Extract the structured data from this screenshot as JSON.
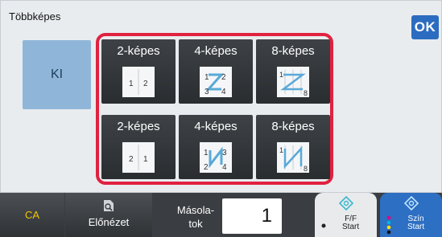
{
  "panel": {
    "title": "Többképes",
    "ok_label": "OK",
    "off_label": "KI"
  },
  "options": [
    {
      "label": "2-képes",
      "icon": "2up-left-right-icon"
    },
    {
      "label": "4-képes",
      "icon": "4up-z-order-icon"
    },
    {
      "label": "8-képes",
      "icon": "8up-z-order-icon"
    },
    {
      "label": "2-képes",
      "icon": "2up-right-left-icon"
    },
    {
      "label": "4-képes",
      "icon": "4up-n-order-icon"
    },
    {
      "label": "8-képes",
      "icon": "8up-n-order-icon"
    }
  ],
  "thumb_text": {
    "two_a": [
      "1",
      "2"
    ],
    "two_b": [
      "2",
      "1"
    ],
    "four_a": [
      "1",
      "2",
      "3",
      "4"
    ],
    "four_b": [
      "1",
      "3",
      "2",
      "4"
    ],
    "eight": [
      "1",
      "8"
    ]
  },
  "bottom": {
    "ca_label": "CA",
    "preview_label": "Előnézet",
    "copies_label_1": "Másola-",
    "copies_label_2": "tok",
    "copies_value": "1",
    "bw_start_1": "F/F",
    "bw_start_2": "Start",
    "color_start_1": "Szín",
    "color_start_2": "Start"
  },
  "colors": {
    "accent": "#2c6cc0",
    "highlight": "#e0223f",
    "ca": "#f2c500"
  }
}
